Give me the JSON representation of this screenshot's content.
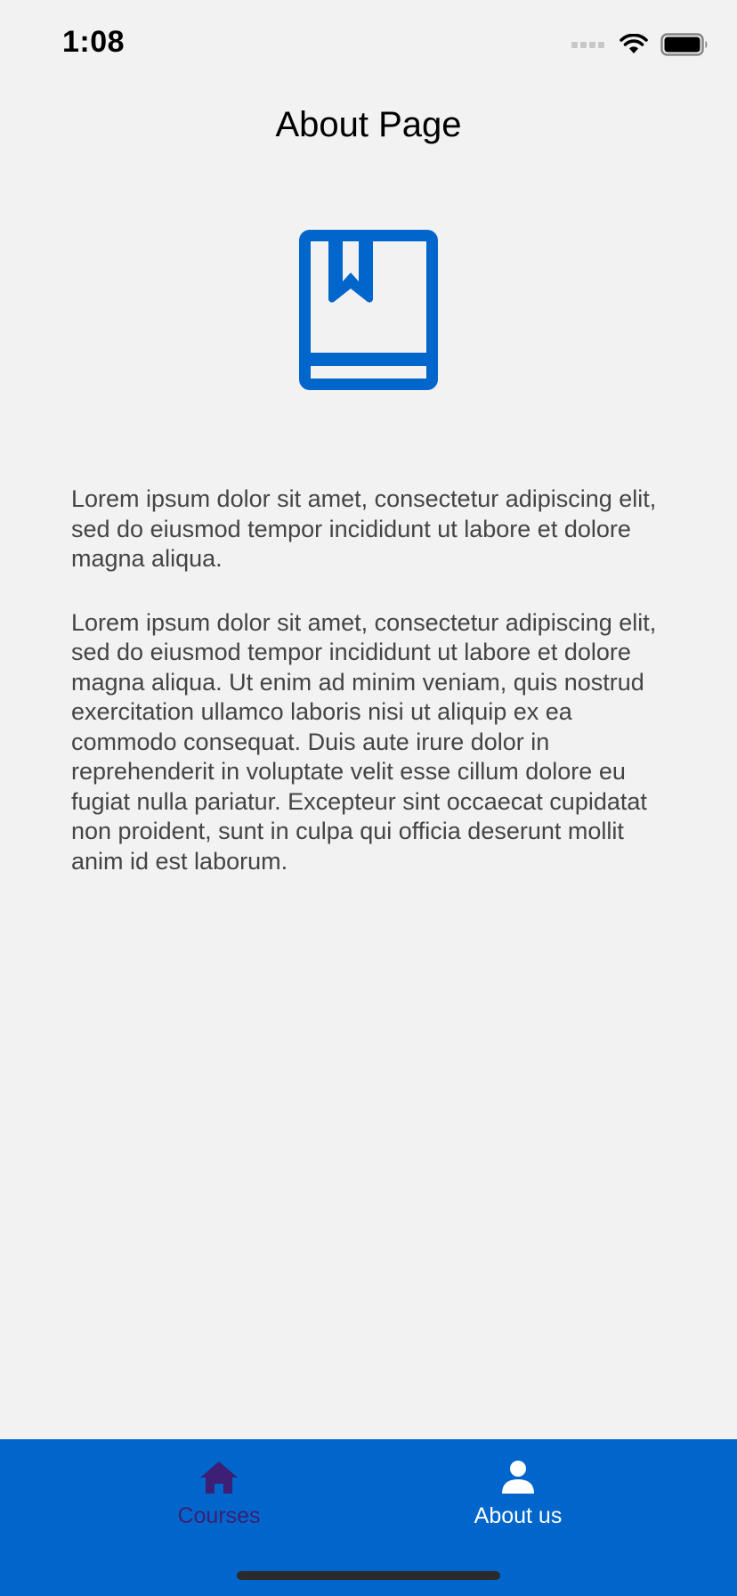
{
  "status_bar": {
    "time": "1:08",
    "icons": [
      "cellular-signal-icon",
      "wifi-icon",
      "battery-icon"
    ]
  },
  "header": {
    "title": "About Page"
  },
  "hero": {
    "icon": "book-bookmark-icon",
    "color": "#0066cc"
  },
  "content": {
    "paragraphs": [
      "Lorem ipsum dolor sit amet, consectetur adipiscing elit, sed do eiusmod tempor incididunt ut labore et dolore magna aliqua.",
      "Lorem ipsum dolor sit amet, consectetur adipiscing elit, sed do eiusmod tempor incididunt ut labore et dolore magna aliqua. Ut enim ad minim veniam, quis nostrud exercitation ullamco laboris nisi ut aliquip ex ea commodo consequat. Duis aute irure dolor in reprehenderit in voluptate velit esse cillum dolore eu fugiat nulla pariatur. Excepteur sint occaecat cupidatat non proident, sunt in culpa qui officia deserunt mollit anim id est laborum."
    ]
  },
  "tab_bar": {
    "background": "#0066cc",
    "tabs": [
      {
        "label": "Courses",
        "icon": "home-icon",
        "color": "#3d1f75"
      },
      {
        "label": "About us",
        "icon": "person-icon",
        "color": "#ffffff"
      }
    ]
  }
}
